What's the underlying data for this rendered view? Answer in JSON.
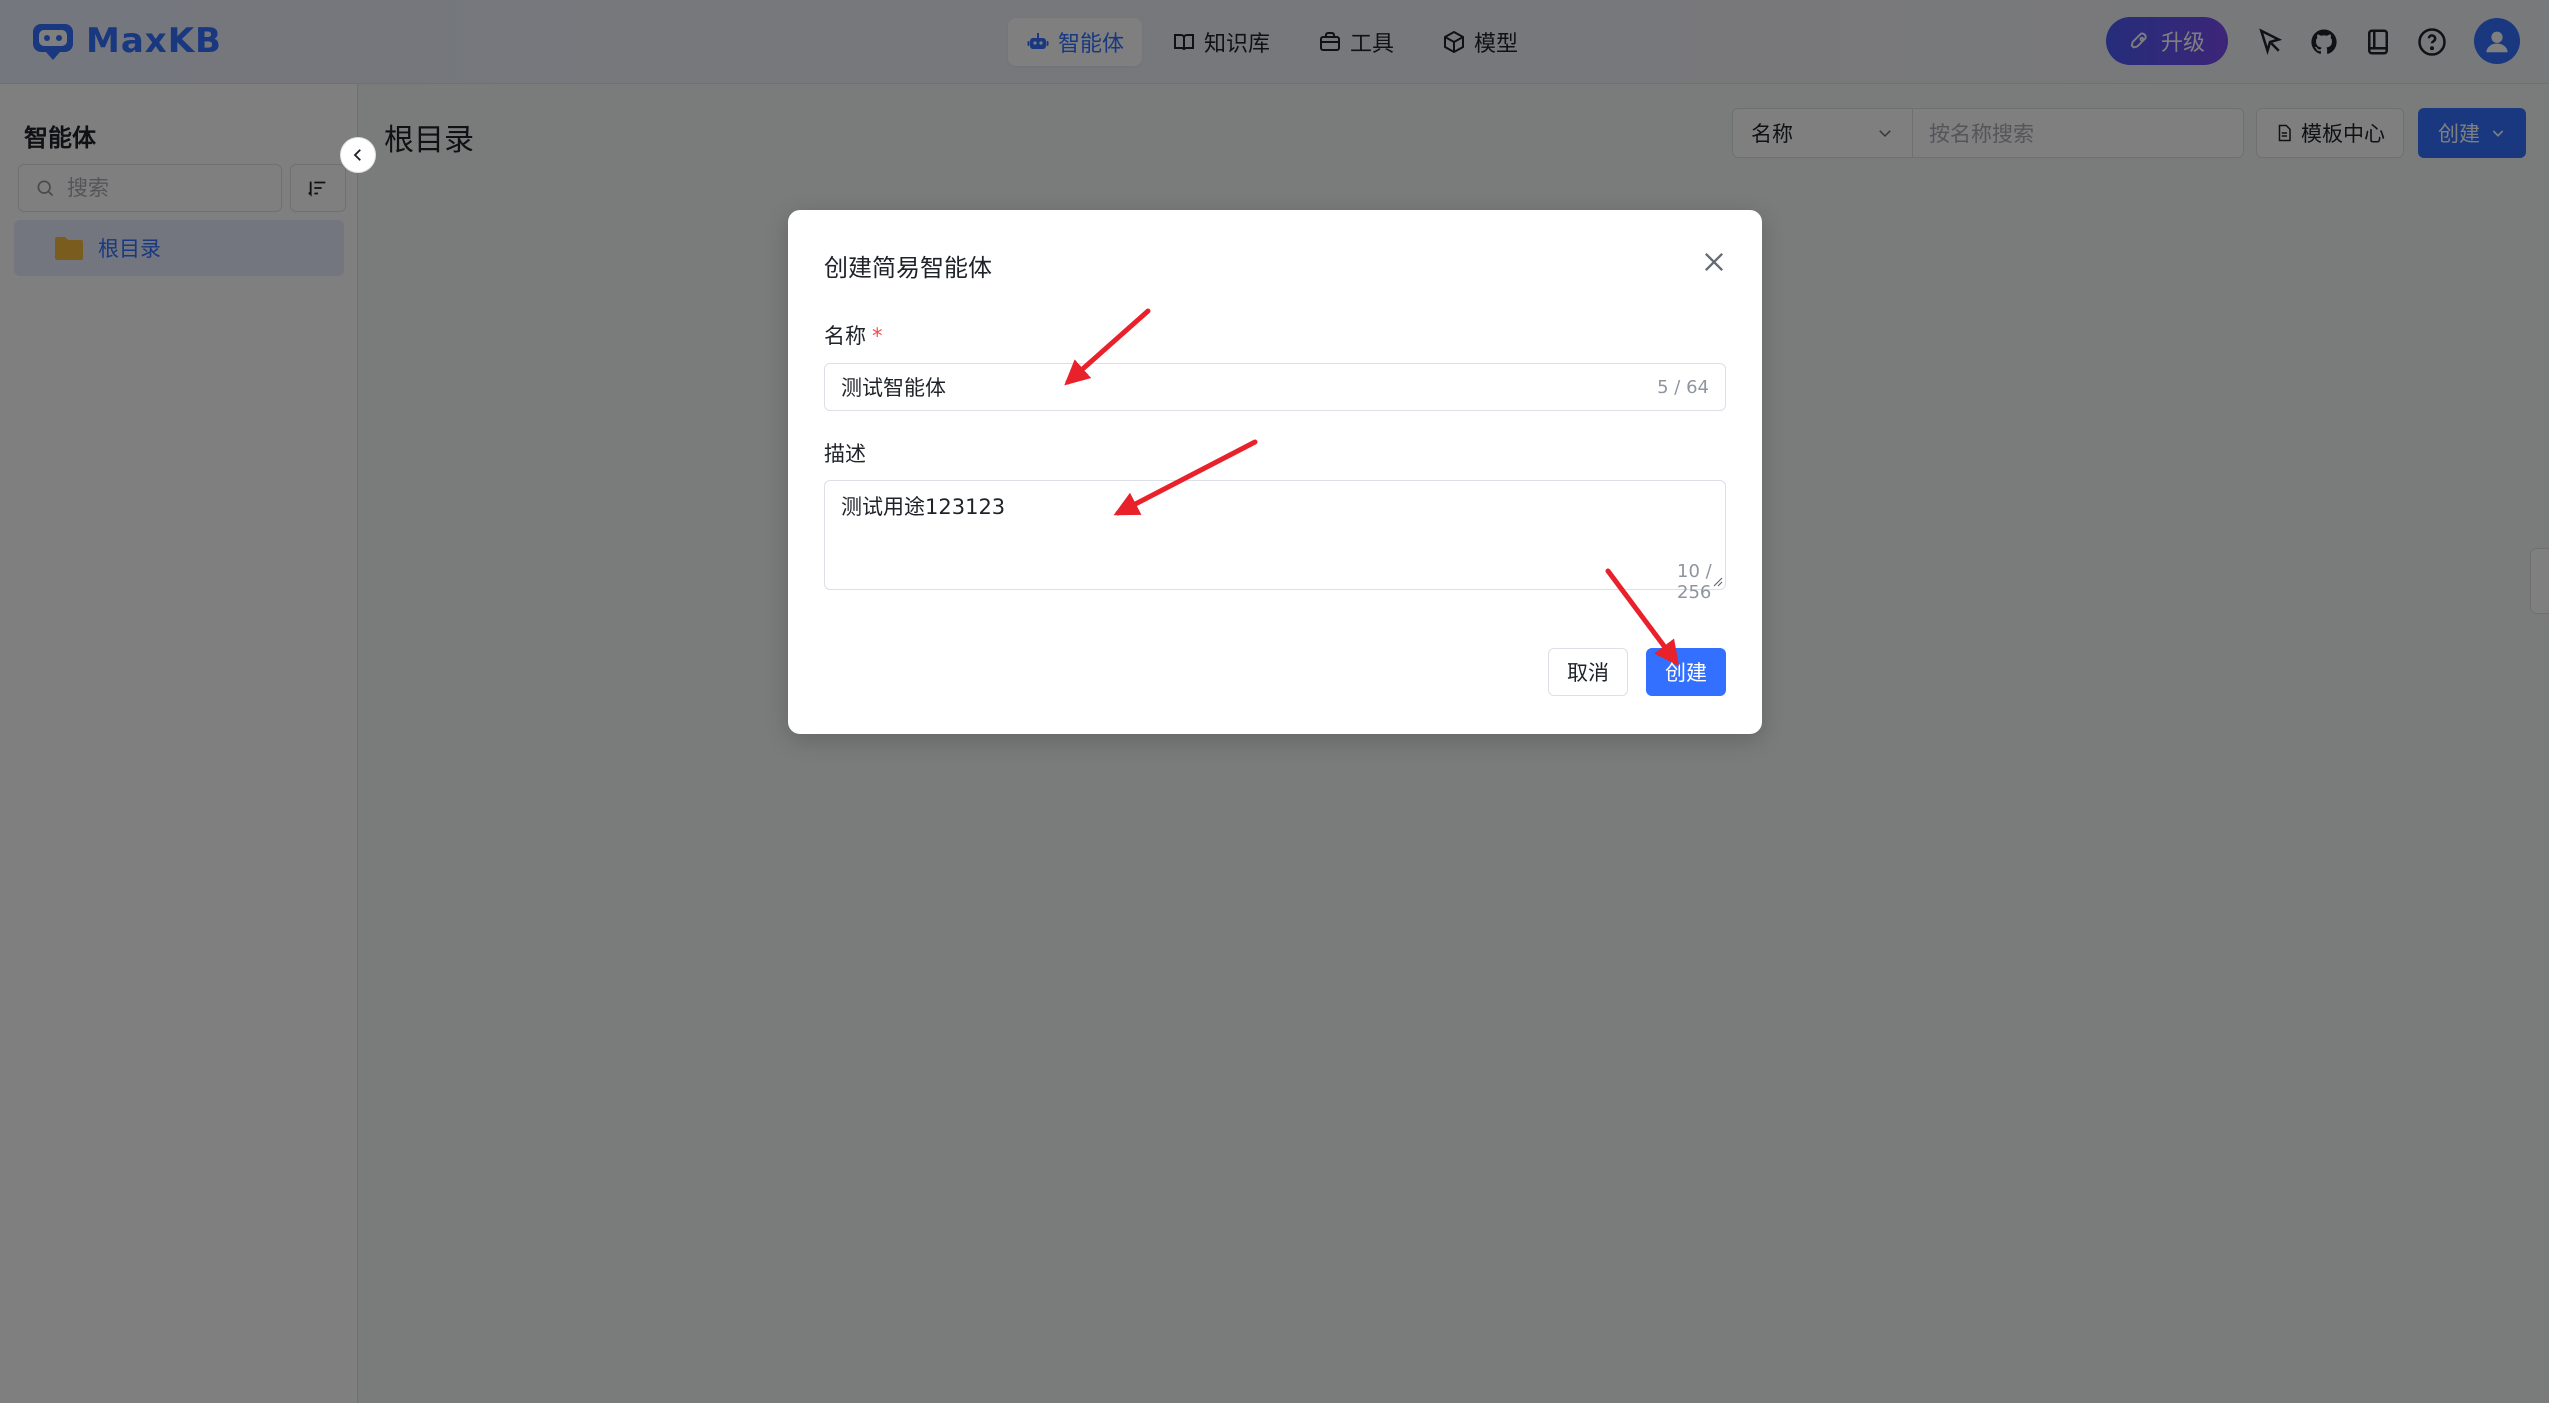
{
  "header": {
    "logo_text": "MaxKB",
    "nav": [
      {
        "label": "智能体",
        "icon": "robot-icon",
        "active": true
      },
      {
        "label": "知识库",
        "icon": "book-open-icon",
        "active": false
      },
      {
        "label": "工具",
        "icon": "toolbox-icon",
        "active": false
      },
      {
        "label": "模型",
        "icon": "cube-icon",
        "active": false
      }
    ],
    "upgrade_label": "升级",
    "icons": [
      "pointer-icon",
      "github-icon",
      "docs-icon",
      "help-icon",
      "avatar"
    ]
  },
  "sidebar": {
    "title": "智能体",
    "search_placeholder": "搜索",
    "tree": [
      {
        "label": "根目录",
        "icon": "folder-icon",
        "selected": true
      }
    ]
  },
  "main": {
    "title": "根目录",
    "filter_select": "名称",
    "filter_placeholder": "按名称搜索",
    "template_label": "模板中心",
    "create_label": "创建"
  },
  "dialog": {
    "title": "创建简易智能体",
    "name_label": "名称",
    "name_required": "*",
    "name_value": "测试智能体",
    "name_counter": "5 / 64",
    "desc_label": "描述",
    "desc_value": "测试用途123123",
    "desc_counter": "10 / 256",
    "cancel_label": "取消",
    "create_label": "创建"
  },
  "colors": {
    "primary": "#3370ff",
    "annotation_arrow": "#e8212b",
    "folder": "#f5b83d",
    "required": "#f54a45"
  }
}
